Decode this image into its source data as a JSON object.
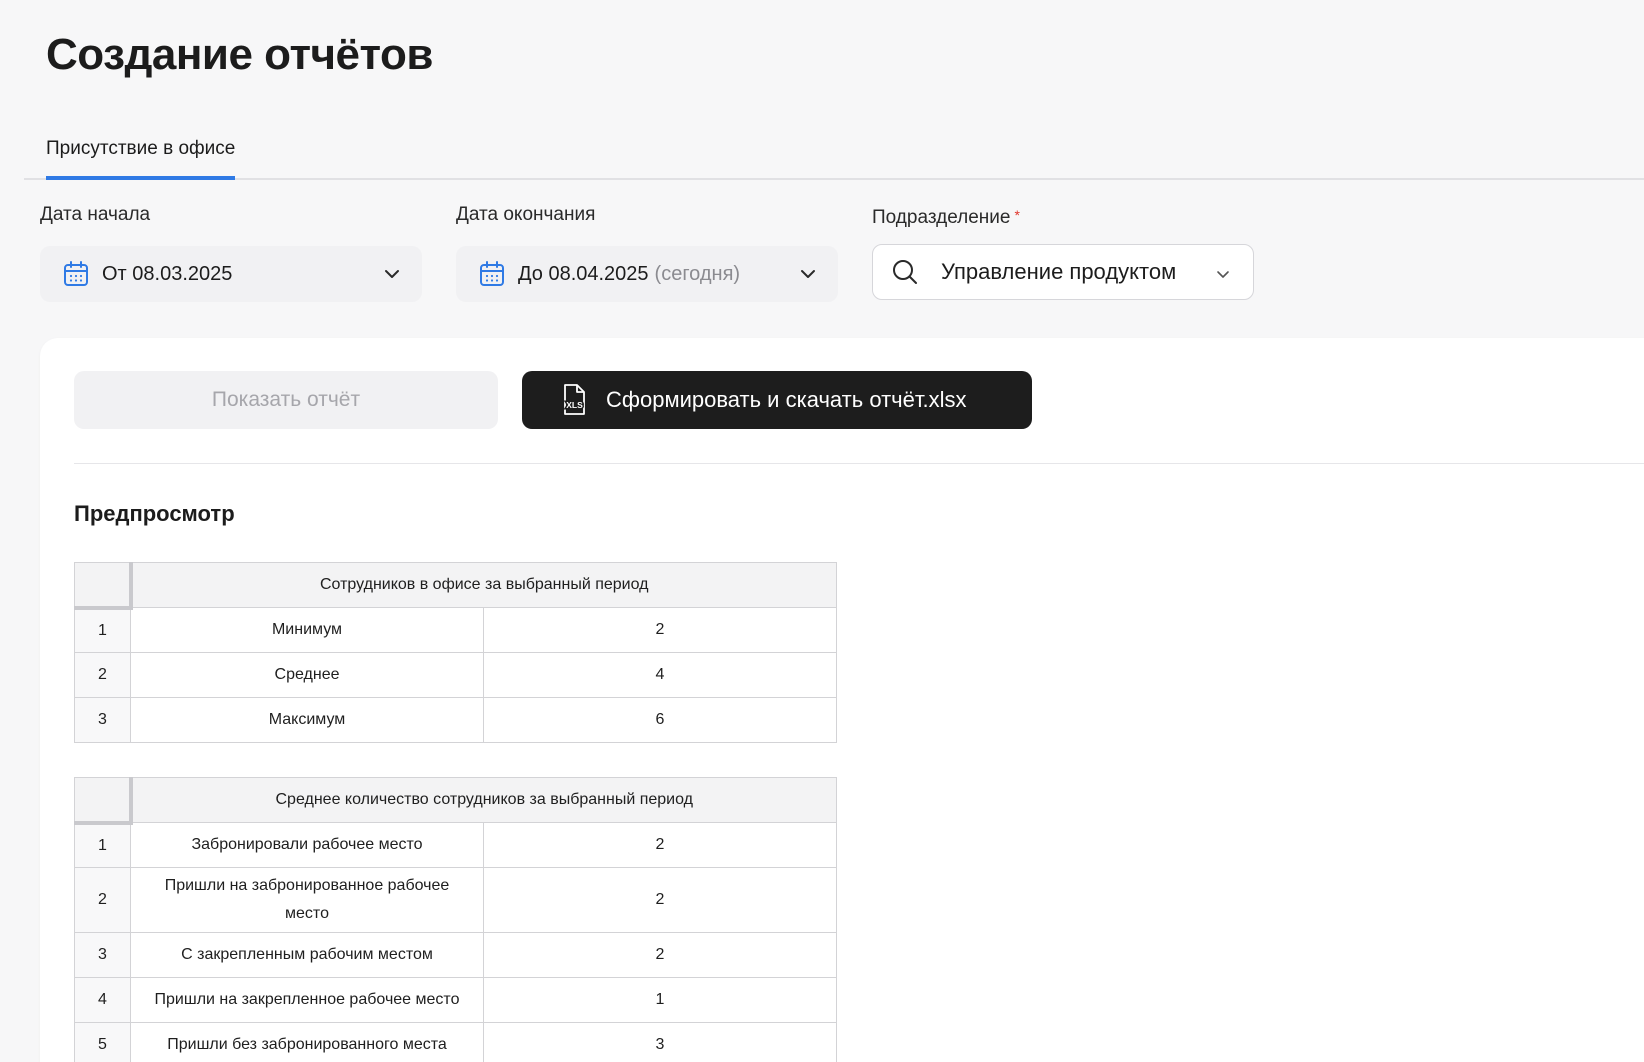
{
  "page": {
    "title": "Создание отчётов"
  },
  "tabs": [
    {
      "label": "Присутствие в офисе",
      "active": true
    }
  ],
  "filters": {
    "start": {
      "label": "Дата начала",
      "value": "От 08.03.2025"
    },
    "end": {
      "label": "Дата окончания",
      "value": "До 08.04.2025",
      "suffix": "(сегодня)"
    },
    "department": {
      "label": "Подразделение",
      "required_mark": "*",
      "value": "Управление продуктом"
    }
  },
  "actions": {
    "show_label": "Показать отчёт",
    "download_label": "Сформировать и скачать отчёт.xlsx"
  },
  "preview": {
    "title": "Предпросмотр",
    "table1": {
      "header": "Сотрудников в офисе за выбранный период",
      "rows": [
        {
          "n": "1",
          "label": "Минимум",
          "value": "2"
        },
        {
          "n": "2",
          "label": "Среднее",
          "value": "4"
        },
        {
          "n": "3",
          "label": "Максимум",
          "value": "6"
        }
      ]
    },
    "table2": {
      "header": "Среднее количество сотрудников за выбранный период",
      "rows": [
        {
          "n": "1",
          "label": "Забронировали рабочее место",
          "value": "2"
        },
        {
          "n": "2",
          "label": "Пришли на забронированное рабочее место",
          "value": "2"
        },
        {
          "n": "3",
          "label": "С закрепленным рабочим местом",
          "value": "2"
        },
        {
          "n": "4",
          "label": "Пришли на закрепленное рабочее место",
          "value": "1"
        },
        {
          "n": "5",
          "label": "Пришли без забронированного места",
          "value": "3"
        }
      ]
    }
  },
  "colors": {
    "accent": "#2f7ae5",
    "primary_button": "#1d1d1d",
    "required": "#e0352b"
  },
  "icons": [
    "calendar-icon",
    "chevron-down-icon",
    "search-icon",
    "xls-file-icon"
  ]
}
